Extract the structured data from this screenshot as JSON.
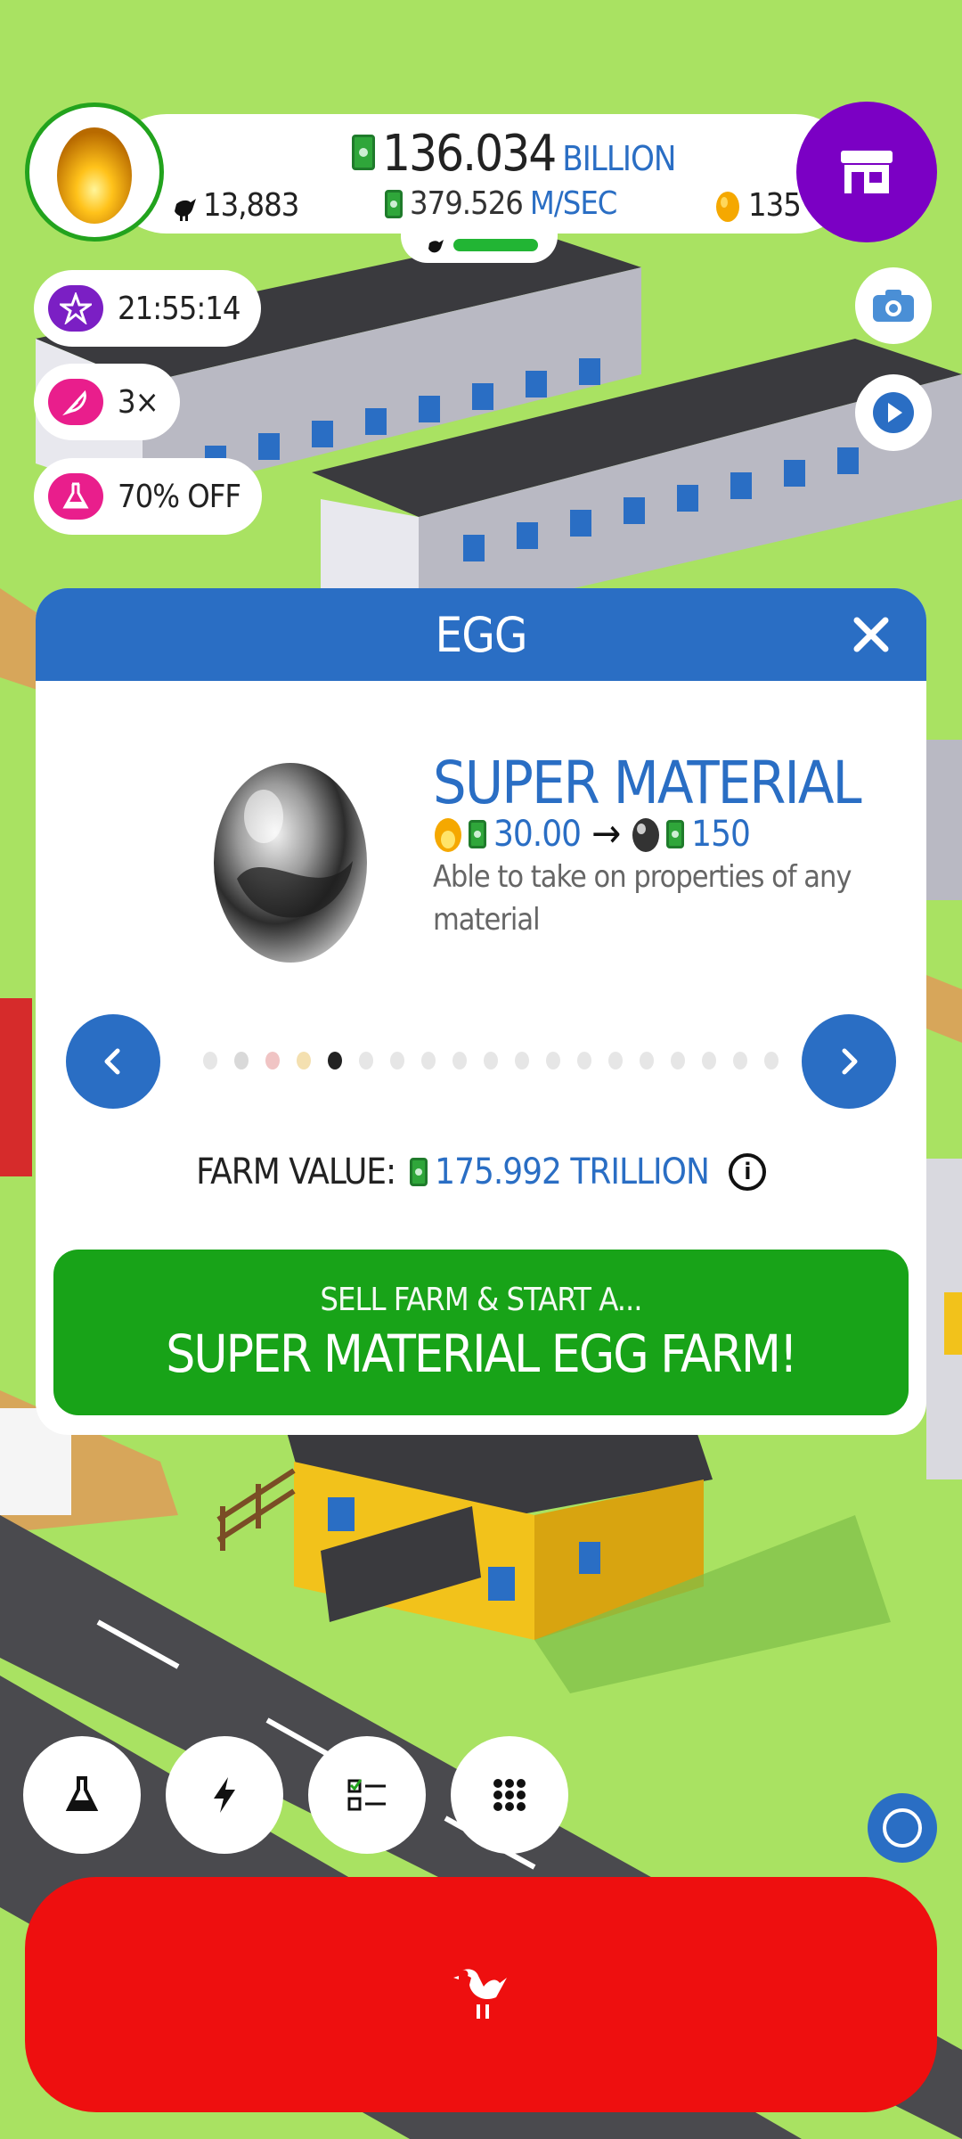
{
  "hud": {
    "money_value": "136.034",
    "money_unit": "BILLION",
    "rate_value": "379.526",
    "rate_unit": "M/SEC",
    "chicken_count": "13,883",
    "golden_eggs": "135",
    "hab_fill_fraction": 0.95
  },
  "status_pills": [
    {
      "icon": "star-icon",
      "text": "21:55:14",
      "color": "#7b1fc4"
    },
    {
      "icon": "feather-icon",
      "text": "3×",
      "color": "#e91e8c"
    },
    {
      "icon": "flask-icon",
      "text": "70% OFF",
      "color": "#e91e8c"
    }
  ],
  "modal": {
    "title": "EGG",
    "egg_name": "SUPER MATERIAL",
    "value_from": "30.00",
    "value_to": "150",
    "description": "Able to take on properties of any material",
    "page_dots": 19,
    "active_dot": 5,
    "farm_value_label": "FARM VALUE:",
    "farm_value": "175.992 TRILLION",
    "sell_small": "SELL FARM & START A...",
    "sell_big": "SUPER MATERIAL EGG FARM!"
  },
  "colors": {
    "grass": "#a9e262",
    "primary_blue": "#2a6ec4",
    "sell_green": "#18a318",
    "shop_purple": "#7b00c4",
    "red_button": "#ee0f0f"
  },
  "bottom_tools": [
    "flask-icon",
    "bolt-icon",
    "checklist-icon",
    "grid-icon"
  ]
}
